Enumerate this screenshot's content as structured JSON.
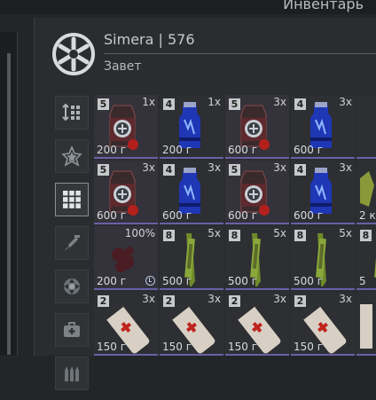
{
  "window": {
    "title": "Инвентарь"
  },
  "agent": {
    "name": "Simera | 576",
    "faction": "Завет"
  },
  "tabs": [
    {
      "icon": "sort-icon"
    },
    {
      "icon": "star-emblem-icon"
    },
    {
      "icon": "grid-icon",
      "active": true
    },
    {
      "icon": "weapon-icon"
    },
    {
      "icon": "artifact-icon"
    },
    {
      "icon": "medkit-icon"
    },
    {
      "icon": "ammo-icon"
    }
  ],
  "colors": {
    "rarity_border": "#6b5fa6",
    "background": "#232628"
  },
  "inventory": [
    {
      "item": "red-stimulant-bottle",
      "tier": "5",
      "qty": "1x",
      "weight": "200 г"
    },
    {
      "item": "blue-energy-drink",
      "tier": "4",
      "qty": "1x",
      "weight": "200 г"
    },
    {
      "item": "red-stimulant-bottle",
      "tier": "5",
      "qty": "3x",
      "weight": "600 г"
    },
    {
      "item": "blue-energy-drink",
      "tier": "4",
      "qty": "3x",
      "weight": "600 г"
    },
    {
      "item": "unknown-partial",
      "tier": "",
      "qty": "",
      "weight": ""
    },
    {
      "item": "red-stimulant-bottle",
      "tier": "5",
      "qty": "3x",
      "weight": "600 г"
    },
    {
      "item": "blue-energy-drink",
      "tier": "4",
      "qty": "3x",
      "weight": "600 г"
    },
    {
      "item": "red-stimulant-bottle",
      "tier": "5",
      "qty": "3x",
      "weight": "600 г"
    },
    {
      "item": "blue-energy-drink",
      "tier": "4",
      "qty": "3x",
      "weight": "600 г"
    },
    {
      "item": "crystal-partial",
      "tier": "",
      "qty": "",
      "weight": "2 к"
    },
    {
      "item": "dark-artifact",
      "tier": "",
      "qty": "100%",
      "weight": "200 г",
      "clock": true
    },
    {
      "item": "green-syringe",
      "tier": "8",
      "qty": "5x",
      "weight": "500 г"
    },
    {
      "item": "green-syringe",
      "tier": "8",
      "qty": "5x",
      "weight": "500 г"
    },
    {
      "item": "green-syringe",
      "tier": "8",
      "qty": "5x",
      "weight": "500 г"
    },
    {
      "item": "green-syringe-partial",
      "tier": "8",
      "qty": "",
      "weight": "5"
    },
    {
      "item": "red-cross-spray",
      "tier": "2",
      "qty": "3x",
      "weight": "150 г"
    },
    {
      "item": "red-cross-spray",
      "tier": "2",
      "qty": "3x",
      "weight": "150 г"
    },
    {
      "item": "red-cross-spray",
      "tier": "2",
      "qty": "3x",
      "weight": "150 г"
    },
    {
      "item": "red-cross-spray",
      "tier": "2",
      "qty": "3x",
      "weight": "150 г"
    },
    {
      "item": "red-cross-spray-partial",
      "tier": "",
      "qty": "",
      "weight": ""
    }
  ]
}
